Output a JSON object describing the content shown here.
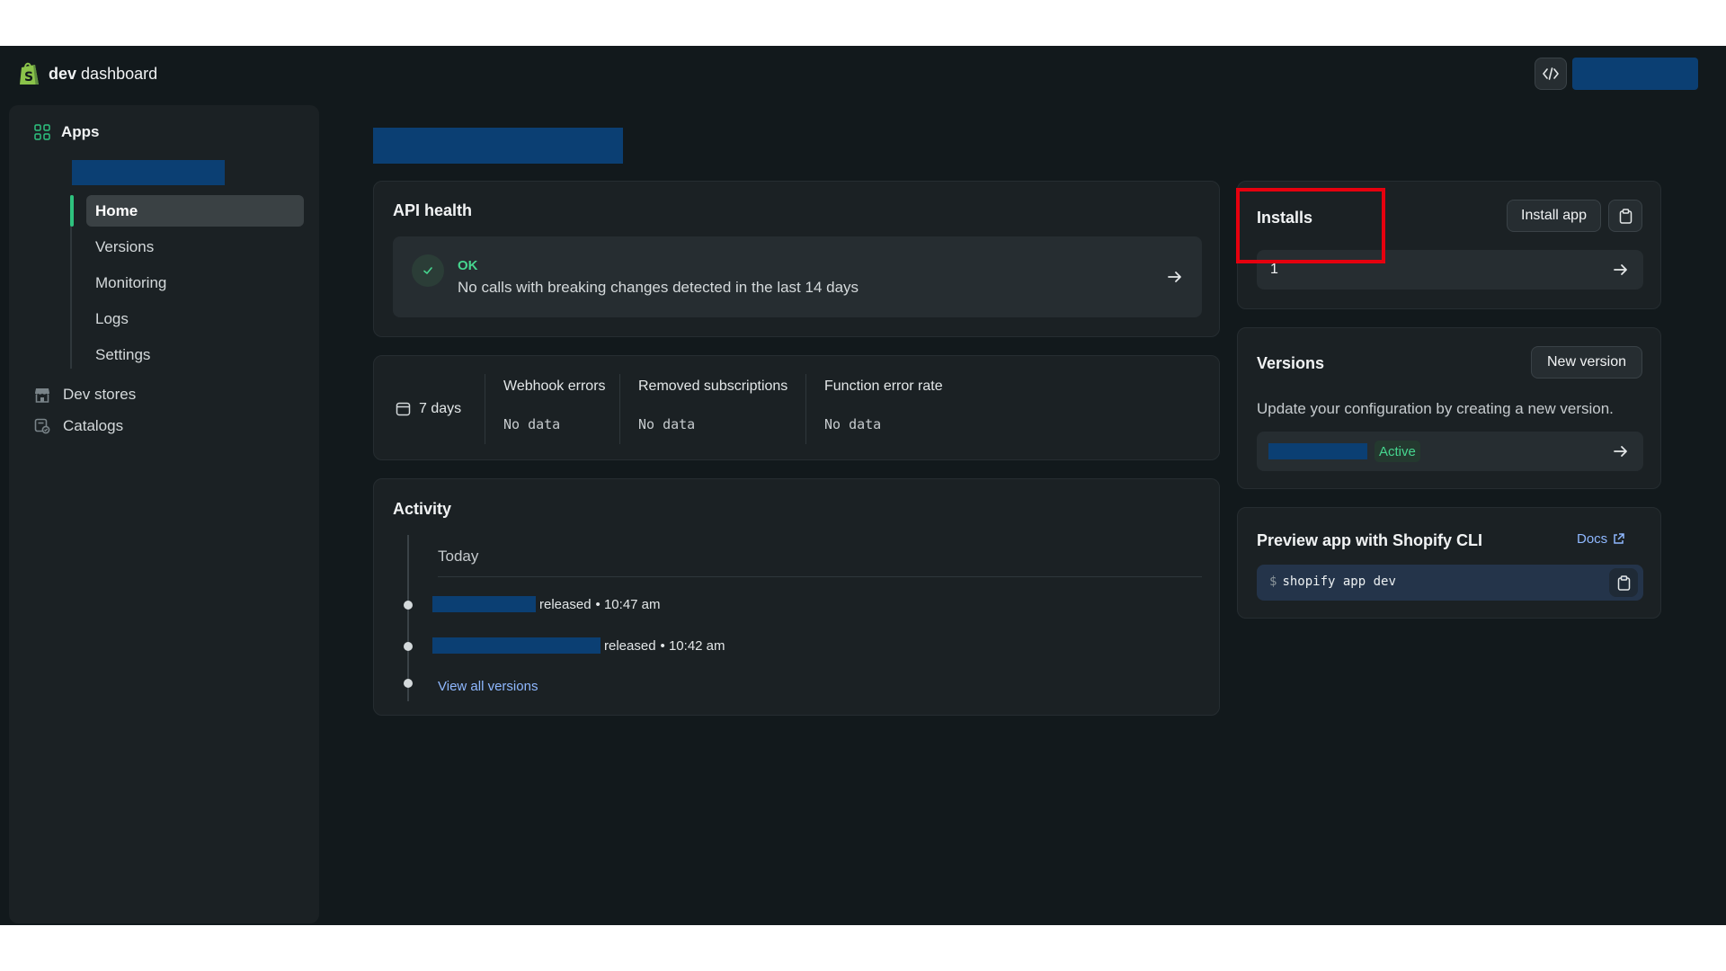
{
  "header": {
    "brand_bold": "dev",
    "brand_rest": "dashboard"
  },
  "sidebar": {
    "apps_label": "Apps",
    "sub_items": [
      {
        "label": "Home",
        "active": true
      },
      {
        "label": "Versions",
        "active": false
      },
      {
        "label": "Monitoring",
        "active": false
      },
      {
        "label": "Logs",
        "active": false
      },
      {
        "label": "Settings",
        "active": false
      }
    ],
    "main_items": [
      {
        "label": "Dev stores",
        "icon": "store-icon"
      },
      {
        "label": "Catalogs",
        "icon": "catalog-icon"
      }
    ]
  },
  "api_health": {
    "title": "API health",
    "status": "OK",
    "description": "No calls with breaking changes detected in the last 14 days"
  },
  "metrics": {
    "range": "7 days",
    "columns": [
      {
        "label": "Webhook errors",
        "value": "No data"
      },
      {
        "label": "Removed subscriptions",
        "value": "No data"
      },
      {
        "label": "Function error rate",
        "value": "No data"
      }
    ]
  },
  "activity": {
    "title": "Activity",
    "day_label": "Today",
    "entries": [
      {
        "action": "released",
        "time": "• 10:47 am"
      },
      {
        "action": "released",
        "time": "• 10:42 am"
      }
    ],
    "view_all": "View all versions"
  },
  "installs": {
    "title": "Installs",
    "install_button": "Install app",
    "count": "1"
  },
  "versions": {
    "title": "Versions",
    "new_button": "New version",
    "description": "Update your configuration by creating a new version.",
    "status": "Active"
  },
  "preview": {
    "title": "Preview app with Shopify CLI",
    "docs_label": "Docs",
    "prompt": "$",
    "command": "shopify app dev"
  },
  "colors": {
    "background": "#12191c",
    "card": "#1b2124",
    "accent_green": "#2ec27e",
    "link_blue": "#8fb8ff",
    "redacted_block": "#0b3f73",
    "highlight_red": "#e6000e"
  }
}
